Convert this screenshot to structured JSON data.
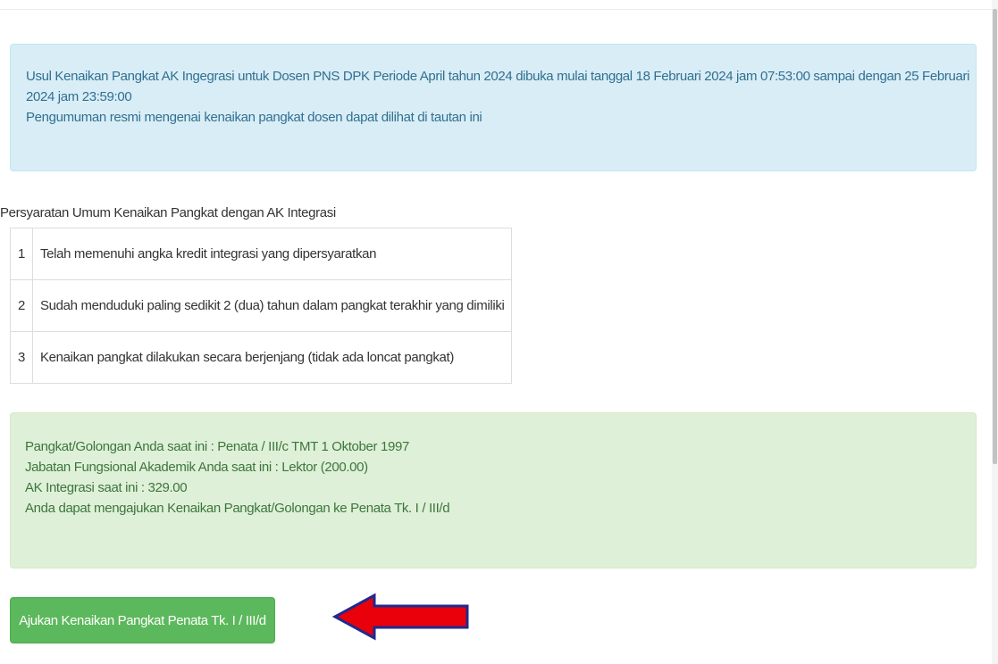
{
  "announcement": {
    "line1": "Usul Kenaikan Pangkat AK Ingegrasi untuk Dosen PNS DPK Periode April tahun 2024 dibuka mulai tanggal 18 Februari 2024 jam 07:53:00 sampai dengan 25 Februari",
    "line2": "2024 jam 23:59:00",
    "line3": "Pengumuman resmi mengenai kenaikan pangkat dosen dapat dilihat di tautan ini"
  },
  "requirements": {
    "title": "Persyaratan Umum Kenaikan Pangkat dengan AK Integrasi",
    "rows": [
      {
        "num": "1",
        "text": "Telah memenuhi angka kredit integrasi yang dipersyaratkan"
      },
      {
        "num": "2",
        "text": "Sudah menduduki paling sedikit 2 (dua) tahun dalam pangkat terakhir yang dimiliki"
      },
      {
        "num": "3",
        "text": "Kenaikan pangkat dilakukan secara berjenjang (tidak ada loncat pangkat)"
      }
    ]
  },
  "status": {
    "pangkat": "Pangkat/Golongan Anda saat ini : Penata / III/c TMT 1 Oktober 1997",
    "jabatan": "Jabatan Fungsional Akademik Anda saat ini : Lektor (200.00)",
    "ak": "AK Integrasi saat ini : 329.00",
    "eligibility": "Anda dapat mengajukan Kenaikan Pangkat/Golongan ke Penata Tk. I / III/d"
  },
  "submit_button": {
    "label": "Ajukan Kenaikan Pangkat Penata Tk. I / III/d"
  },
  "colors": {
    "info_bg": "#d9edf7",
    "info_text": "#31708f",
    "success_bg": "#dff0d8",
    "success_text": "#3c763d",
    "button_bg": "#5cb85c",
    "arrow_fill": "#e8000b",
    "arrow_outline": "#1f2a8f"
  },
  "annotation": {
    "icon": "left-arrow-icon"
  }
}
